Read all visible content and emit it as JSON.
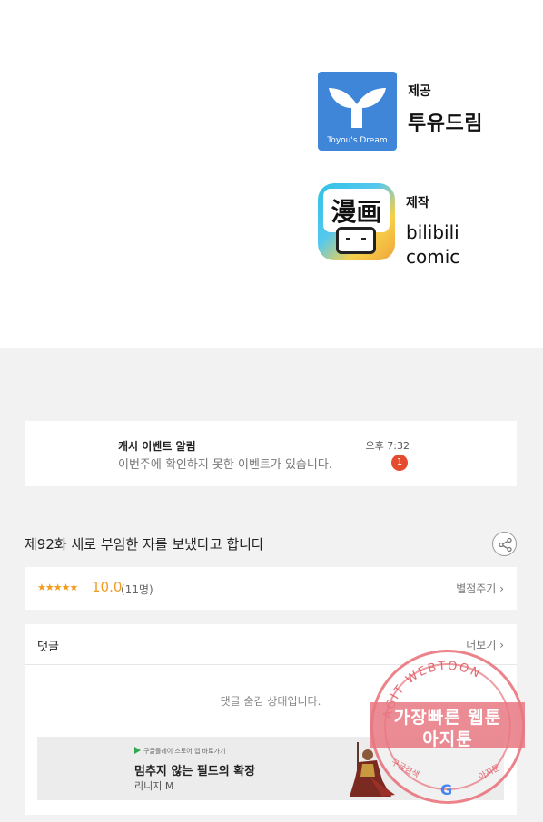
{
  "credits": [
    {
      "role": "제공",
      "name": "투유드림",
      "logo_caption": "Toyou's Dream",
      "logo_icon": "toyou-dream-logo"
    },
    {
      "role": "제작",
      "name_lines": [
        "bilibili",
        "comic"
      ],
      "logo_text": "漫画",
      "logo_icon": "bilibili-comic-logo"
    }
  ],
  "notification": {
    "title": "캐시 이벤트 알림",
    "message": "이번주에 확인하지 못한 이벤트가 있습니다.",
    "time": "오후 7:32",
    "count": "1"
  },
  "episode": {
    "title": "제92화 새로 부임한 자를 보냈다고 합니다",
    "share_icon": "share-icon"
  },
  "rating": {
    "stars": "★★★★★",
    "score": "10.0",
    "count": "(11명)",
    "rate_label": "별점주기"
  },
  "comments": {
    "label": "댓글",
    "more_label": "더보기",
    "hidden_text": "댓글 숨김 상태입니다."
  },
  "ad": {
    "source": "구글플레이 스토어 앱 바로가기",
    "headline": "멈추지 않는 필드의 확장",
    "subtitle": "리니지 M"
  },
  "watermark": {
    "arc_text": "AGIT WEBTOON",
    "line1": "가장빠른 웹툰",
    "line2": "아지툰",
    "left_small": "구글검색",
    "right_small": "아지툰",
    "g_letter": "G"
  },
  "colors": {
    "accent_orange": "#f29c1f",
    "badge_red": "#e44b2f",
    "toyou_blue": "#3f86d8"
  }
}
